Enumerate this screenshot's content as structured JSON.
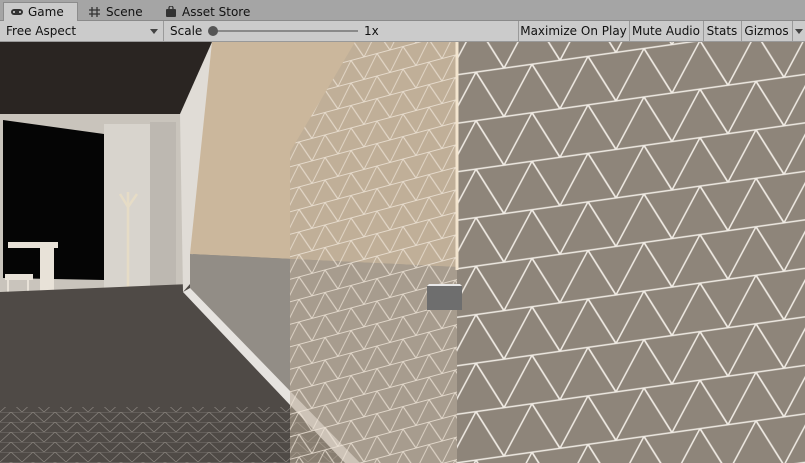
{
  "tabs": [
    {
      "label": "Game",
      "icon": "gamepad-icon",
      "active": true
    },
    {
      "label": "Scene",
      "icon": "grid-icon",
      "active": false
    },
    {
      "label": "Asset Store",
      "icon": "bag-icon",
      "active": false
    }
  ],
  "toolbar": {
    "aspect": "Free Aspect",
    "scale_label": "Scale",
    "scale_value": "1x",
    "maximize_label": "Maximize On Play",
    "mute_label": "Mute Audio",
    "stats_label": "Stats",
    "gizmos_label": "Gizmos"
  },
  "colors": {
    "tab_bar": "#a5a5a5",
    "toolbar": "#cbcbcb",
    "wall": "#8e857a",
    "wall_grid": "#f0ebe4",
    "floor": "#4f4a46",
    "warm_wall": "#cbb79c"
  }
}
